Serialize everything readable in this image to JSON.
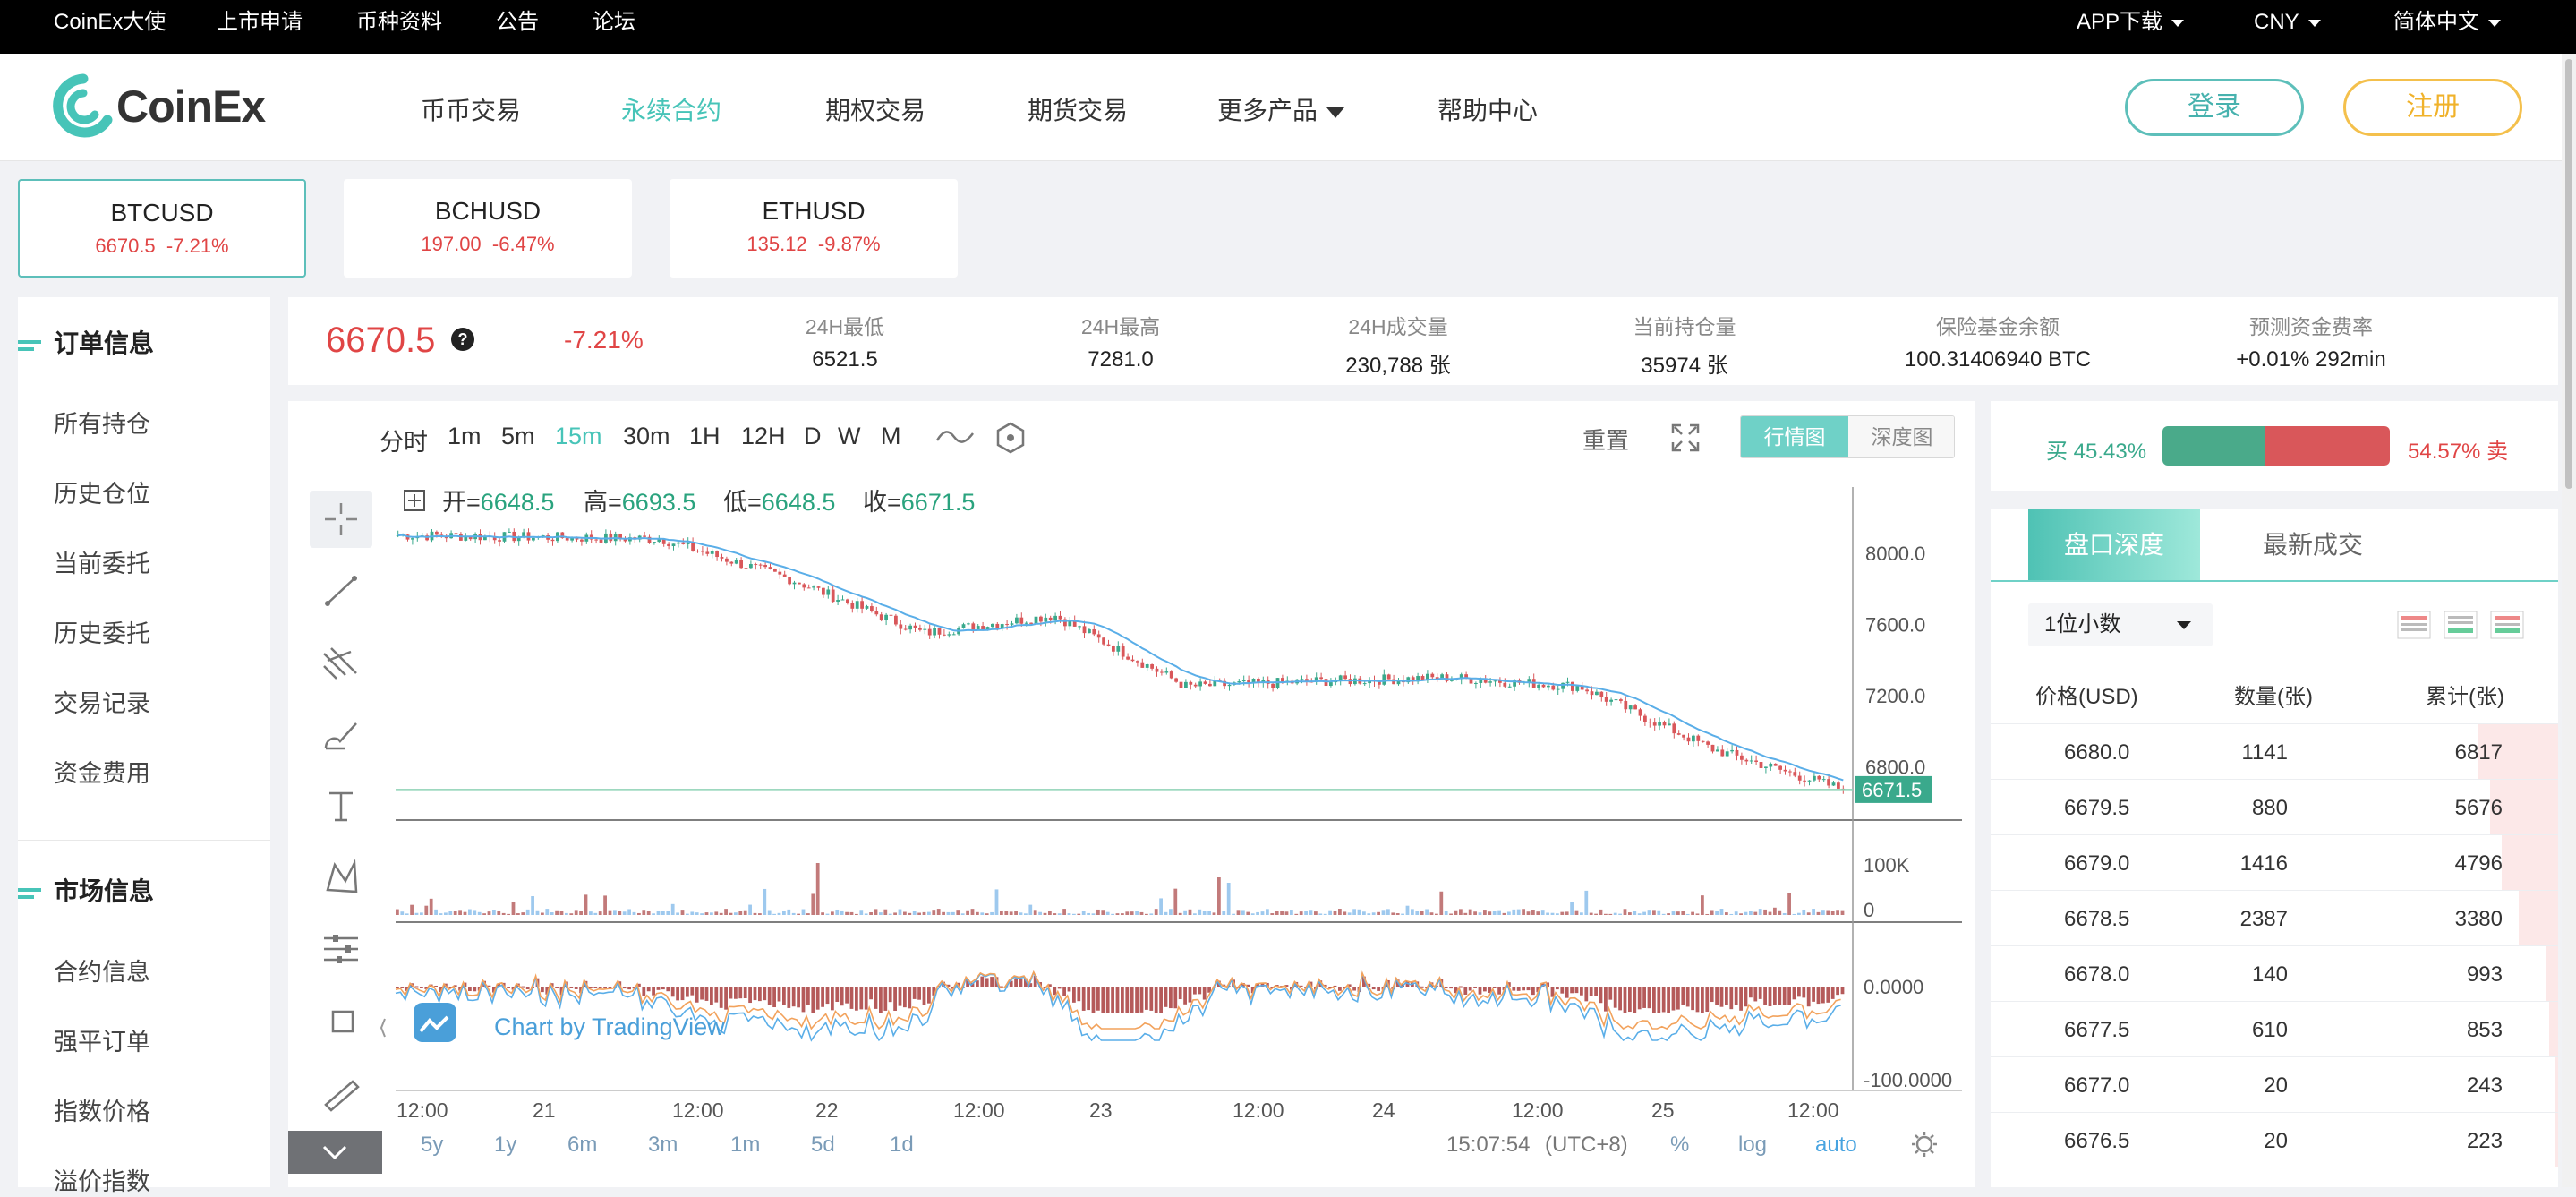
{
  "topbar": {
    "left": [
      "CoinEx大使",
      "上市申请",
      "币种资料",
      "公告",
      "论坛"
    ],
    "app": "APP下载",
    "currency": "CNY",
    "lang": "简体中文"
  },
  "header": {
    "logo_text": "CoinEx",
    "nav": [
      "币币交易",
      "永续合约",
      "期权交易",
      "期货交易",
      "更多产品",
      "帮助中心"
    ],
    "active_nav": "永续合约",
    "login": "登录",
    "register": "注册"
  },
  "tickers": [
    {
      "symbol": "BTCUSD",
      "price": "6670.5",
      "change": "-7.21%"
    },
    {
      "symbol": "BCHUSD",
      "price": "197.00",
      "change": "-6.47%"
    },
    {
      "symbol": "ETHUSD",
      "price": "135.12",
      "change": "-9.87%"
    }
  ],
  "sidebar": {
    "section1": "订单信息",
    "items1": [
      "所有持仓",
      "历史仓位",
      "当前委托",
      "历史委托",
      "交易记录",
      "资金费用"
    ],
    "section2": "市场信息",
    "items2": [
      "合约信息",
      "强平订单",
      "指数价格",
      "溢价指数"
    ]
  },
  "stats": {
    "price": "6670.5",
    "change": "-7.21%",
    "items": [
      {
        "label": "24H最低",
        "value": "6521.5"
      },
      {
        "label": "24H最高",
        "value": "7281.0"
      },
      {
        "label": "24H成交量",
        "value": "230,788 张"
      },
      {
        "label": "当前持仓量",
        "value": "35974 张"
      },
      {
        "label": "保险基金余额",
        "value": "100.31406940 BTC"
      },
      {
        "label": "预测资金费率",
        "value": "+0.01% 292min"
      }
    ]
  },
  "chart_toolbar": {
    "timeframes": [
      "分时",
      "1m",
      "5m",
      "15m",
      "30m",
      "1H",
      "12H",
      "D",
      "W",
      "M"
    ],
    "active": "15m",
    "reset": "重置",
    "tab_market": "行情图",
    "tab_depth": "深度图"
  },
  "ohlc": {
    "open_label": "开=",
    "open": "6648.5",
    "high_label": "高=",
    "high": "6693.5",
    "low_label": "低=",
    "low": "6648.5",
    "close_label": "收=",
    "close": "6671.5"
  },
  "chart_labels": {
    "price_ticks": [
      "8000.0",
      "7600.0",
      "7200.0",
      "6800.0"
    ],
    "last_price": "6671.5",
    "volume_ticks": [
      "100K",
      "0"
    ],
    "macd_ticks": [
      "0.0000",
      "-100.0000"
    ],
    "x_ticks": [
      "12:00",
      "21",
      "12:00",
      "22",
      "12:00",
      "23",
      "12:00",
      "24",
      "12:00",
      "25",
      "12:00"
    ],
    "watermark": "Chart by TradingView",
    "ranges": [
      "5y",
      "1y",
      "6m",
      "3m",
      "1m",
      "5d",
      "1d"
    ],
    "time": "15:07:54",
    "tz": "(UTC+8)",
    "pct": "%",
    "log": "log",
    "auto": "auto"
  },
  "chart_data": {
    "type": "line",
    "title": "",
    "x": [
      "20 12:00",
      "21 00:00",
      "21 12:00",
      "22 00:00",
      "22 12:00",
      "23 00:00",
      "23 12:00",
      "24 00:00",
      "24 12:00",
      "25 00:00",
      "25 12:00",
      "25 15:00"
    ],
    "series": [
      {
        "values": [
          8100,
          8090,
          8080,
          7850,
          7550,
          7650,
          7250,
          7280,
          7300,
          7250,
          6900,
          6671.5
        ]
      }
    ],
    "ylim": [
      6500,
      8200
    ],
    "price_ticks": [
      8000,
      7600,
      7200,
      6800
    ],
    "last": 6671.5
  },
  "depth_ratio": {
    "buy": "买 45.43%",
    "sell": "54.57% 卖",
    "buy_pct": 45.43
  },
  "orderbook": {
    "tab1": "盘口深度",
    "tab2": "最新成交",
    "precision": "1位小数",
    "headers": [
      "价格(USD)",
      "数量(张)",
      "累计(张)"
    ],
    "rows": [
      {
        "price": "6680.0",
        "qty": "1141",
        "total": "6817",
        "depth": 0.14
      },
      {
        "price": "6679.5",
        "qty": "880",
        "total": "5676",
        "depth": 0.12
      },
      {
        "price": "6679.0",
        "qty": "1416",
        "total": "4796",
        "depth": 0.1
      },
      {
        "price": "6678.5",
        "qty": "2387",
        "total": "3380",
        "depth": 0.07
      },
      {
        "price": "6678.0",
        "qty": "140",
        "total": "993",
        "depth": 0.02
      },
      {
        "price": "6677.5",
        "qty": "610",
        "total": "853",
        "depth": 0.015
      },
      {
        "price": "6677.0",
        "qty": "20",
        "total": "243",
        "depth": 0.006
      },
      {
        "price": "6676.5",
        "qty": "20",
        "total": "223",
        "depth": 0.005
      }
    ]
  },
  "colors": {
    "accent": "#47c4b8",
    "down": "#e04545",
    "up": "#3aa98c",
    "gold": "#f0b22a"
  }
}
